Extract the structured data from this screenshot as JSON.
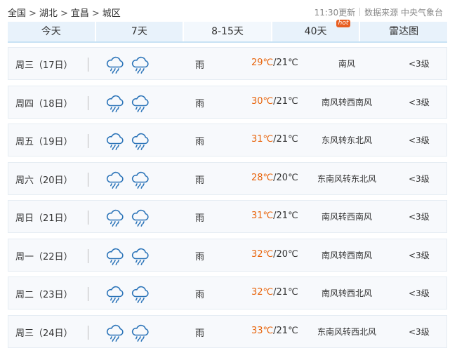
{
  "breadcrumb": [
    "全国",
    "湖北",
    "宜昌",
    "城区"
  ],
  "breadcrumb_separator": ">",
  "update_time": "11:30更新",
  "source": "数据来源 中央气象台",
  "tabs": [
    {
      "label": "今天",
      "active": false
    },
    {
      "label": "7天",
      "active": false
    },
    {
      "label": "8-15天",
      "active": true
    },
    {
      "label": "40天",
      "badge": "hot",
      "active": false
    },
    {
      "label": "雷达图",
      "active": false
    }
  ],
  "colors": {
    "tab_bg": "#e8f2fb",
    "high_temp": "#e8640b",
    "badge": "#e85e21",
    "icon": "#2a73b8"
  },
  "forecast": [
    {
      "date": "周三（17日）",
      "icons": [
        "rain-icon",
        "rain-icon"
      ],
      "condition": "雨",
      "high": "29℃",
      "low": "/21℃",
      "wind": "南风",
      "level": "<3级"
    },
    {
      "date": "周四（18日）",
      "icons": [
        "rain-icon",
        "rain-icon"
      ],
      "condition": "雨",
      "high": "30℃",
      "low": "/21℃",
      "wind": "南风转西南风",
      "level": "<3级"
    },
    {
      "date": "周五（19日）",
      "icons": [
        "rain-icon",
        "rain-icon"
      ],
      "condition": "雨",
      "high": "31℃",
      "low": "/21℃",
      "wind": "东风转东北风",
      "level": "<3级"
    },
    {
      "date": "周六（20日）",
      "icons": [
        "rain-icon",
        "rain-icon"
      ],
      "condition": "雨",
      "high": "28℃",
      "low": "/20℃",
      "wind": "东南风转东北风",
      "level": "<3级"
    },
    {
      "date": "周日（21日）",
      "icons": [
        "rain-icon",
        "rain-icon"
      ],
      "condition": "雨",
      "high": "31℃",
      "low": "/21℃",
      "wind": "南风转西南风",
      "level": "<3级"
    },
    {
      "date": "周一（22日）",
      "icons": [
        "rain-icon",
        "rain-icon"
      ],
      "condition": "雨",
      "high": "32℃",
      "low": "/20℃",
      "wind": "南风转西南风",
      "level": "<3级"
    },
    {
      "date": "周二（23日）",
      "icons": [
        "rain-icon",
        "rain-icon"
      ],
      "condition": "雨",
      "high": "32℃",
      "low": "/21℃",
      "wind": "南风转西北风",
      "level": "<3级"
    },
    {
      "date": "周三（24日）",
      "icons": [
        "rain-icon",
        "rain-icon"
      ],
      "condition": "雨",
      "high": "33℃",
      "low": "/21℃",
      "wind": "东南风转西北风",
      "level": "<3级"
    }
  ]
}
